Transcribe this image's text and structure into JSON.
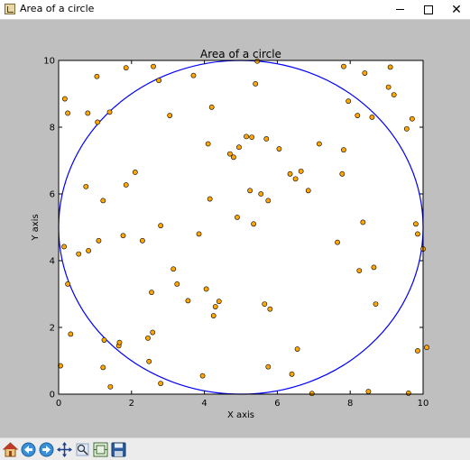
{
  "window": {
    "title": "Area of a circle",
    "controls": {
      "minimize": "minimize-icon",
      "maximize": "maximize-icon",
      "close": "close-icon"
    }
  },
  "toolbar": {
    "items": [
      "home-icon",
      "back-arrow-icon",
      "forward-arrow-icon",
      "pan-icon",
      "zoom-icon",
      "configure-subplots-icon",
      "save-icon"
    ]
  },
  "colors": {
    "figure_bg": "#bfbfbf",
    "axes_bg": "#ffffff",
    "circle": "#0000ff",
    "points": "#ffa500",
    "point_edge": "#000000"
  },
  "chart_data": {
    "type": "scatter",
    "title": "Area of a circle",
    "xlabel": "X axis",
    "ylabel": "Y axis",
    "xlim": [
      0,
      10
    ],
    "ylim": [
      0,
      10
    ],
    "xticks": [
      "0",
      "2",
      "4",
      "6",
      "8",
      "10"
    ],
    "yticks": [
      "0",
      "2",
      "4",
      "6",
      "8",
      "10"
    ],
    "grid": false,
    "legend": "none",
    "circle": {
      "center": [
        5,
        5
      ],
      "radius": 5
    },
    "points": [
      [
        0.17,
        8.85
      ],
      [
        0.25,
        8.42
      ],
      [
        0.05,
        0.85
      ],
      [
        0.15,
        4.42
      ],
      [
        0.25,
        3.3
      ],
      [
        0.33,
        1.8
      ],
      [
        0.55,
        4.2
      ],
      [
        0.75,
        6.22
      ],
      [
        0.8,
        8.42
      ],
      [
        0.82,
        4.3
      ],
      [
        1.05,
        9.52
      ],
      [
        1.07,
        8.15
      ],
      [
        1.1,
        4.6
      ],
      [
        1.22,
        5.8
      ],
      [
        1.25,
        1.62
      ],
      [
        1.22,
        0.8
      ],
      [
        1.4,
        8.45
      ],
      [
        1.42,
        0.22
      ],
      [
        1.65,
        1.45
      ],
      [
        1.67,
        1.55
      ],
      [
        1.77,
        4.75
      ],
      [
        1.85,
        9.78
      ],
      [
        1.85,
        6.27
      ],
      [
        2.1,
        6.65
      ],
      [
        2.3,
        4.6
      ],
      [
        2.45,
        1.68
      ],
      [
        2.48,
        0.98
      ],
      [
        2.55,
        3.05
      ],
      [
        2.58,
        1.85
      ],
      [
        2.6,
        9.82
      ],
      [
        2.75,
        9.4
      ],
      [
        2.8,
        5.05
      ],
      [
        2.8,
        0.32
      ],
      [
        3.05,
        8.35
      ],
      [
        3.15,
        3.75
      ],
      [
        3.25,
        3.3
      ],
      [
        3.55,
        2.8
      ],
      [
        3.7,
        9.55
      ],
      [
        3.85,
        4.8
      ],
      [
        3.95,
        0.55
      ],
      [
        4.05,
        3.15
      ],
      [
        4.1,
        7.5
      ],
      [
        4.15,
        5.85
      ],
      [
        4.2,
        8.6
      ],
      [
        4.25,
        2.35
      ],
      [
        4.3,
        2.62
      ],
      [
        4.4,
        2.78
      ],
      [
        4.7,
        7.2
      ],
      [
        4.8,
        7.1
      ],
      [
        4.9,
        5.3
      ],
      [
        4.95,
        7.4
      ],
      [
        5.15,
        7.72
      ],
      [
        5.25,
        6.1
      ],
      [
        5.3,
        7.7
      ],
      [
        5.35,
        5.1
      ],
      [
        5.4,
        9.3
      ],
      [
        5.45,
        9.98
      ],
      [
        5.55,
        6.0
      ],
      [
        5.65,
        2.7
      ],
      [
        5.75,
        0.82
      ],
      [
        5.7,
        7.65
      ],
      [
        5.75,
        5.8
      ],
      [
        5.8,
        2.55
      ],
      [
        6.05,
        7.35
      ],
      [
        6.35,
        6.6
      ],
      [
        6.4,
        0.6
      ],
      [
        6.5,
        6.45
      ],
      [
        6.55,
        1.35
      ],
      [
        6.65,
        6.68
      ],
      [
        6.85,
        6.1
      ],
      [
        6.95,
        0.02
      ],
      [
        7.15,
        7.5
      ],
      [
        7.65,
        4.55
      ],
      [
        7.78,
        6.6
      ],
      [
        7.82,
        7.32
      ],
      [
        7.82,
        9.82
      ],
      [
        7.95,
        8.78
      ],
      [
        8.2,
        8.35
      ],
      [
        8.25,
        3.7
      ],
      [
        8.35,
        5.15
      ],
      [
        8.4,
        9.62
      ],
      [
        8.5,
        0.08
      ],
      [
        8.6,
        8.3
      ],
      [
        8.65,
        3.8
      ],
      [
        8.7,
        2.7
      ],
      [
        9.05,
        9.2
      ],
      [
        9.1,
        9.8
      ],
      [
        9.2,
        8.97
      ],
      [
        9.55,
        7.95
      ],
      [
        9.6,
        0.03
      ],
      [
        9.7,
        8.25
      ],
      [
        9.8,
        5.1
      ],
      [
        9.85,
        4.8
      ],
      [
        9.85,
        1.3
      ],
      [
        10.0,
        4.35
      ],
      [
        10.1,
        1.4
      ]
    ]
  }
}
